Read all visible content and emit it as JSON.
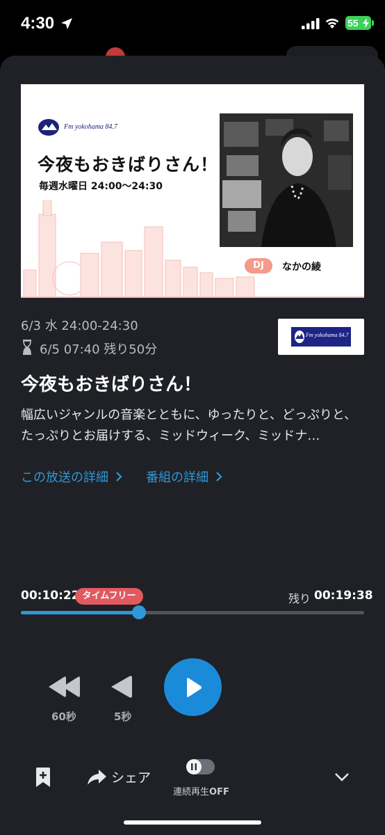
{
  "status_bar": {
    "time": "4:30",
    "battery": "55"
  },
  "banner": {
    "station_name": "Fm yokohama 84.7",
    "title": "今夜もおきばりさん！",
    "schedule": "毎週水曜日 24:00〜24:30",
    "dj_tag": "DJ",
    "dj_name": "なかの綾"
  },
  "episode": {
    "broadcast_datetime": "6/3 水 24:00-24:30",
    "expire_text": "6/5 07:40",
    "remaining_days_text": "残り50分",
    "station_logo_text": "Fm yokohama 84.7",
    "title": "今夜もおきばりさん！",
    "description": "幅広いジャンルの音楽とともに、ゆったりと、どっぷりと、たっぷりとお届けする、ミッドウィーク、ミッドナ…"
  },
  "links": {
    "broadcast_details": "この放送の詳細",
    "program_details": "番組の詳細"
  },
  "player": {
    "current_time": "00:10:22",
    "badge": "タイムフリー",
    "remaining_label": "残り",
    "remaining_time": "00:19:38",
    "progress_fraction": 0.345,
    "rewind_60_label": "60秒",
    "rewind_5_label": "5秒"
  },
  "bottom_bar": {
    "share_label": "シェア",
    "autoplay_label_prefix": "連続再生",
    "autoplay_label_state": "OFF"
  },
  "colors": {
    "accent": "#2e98d8",
    "badge": "#e05a5f",
    "sheet_bg": "#1f2126"
  }
}
